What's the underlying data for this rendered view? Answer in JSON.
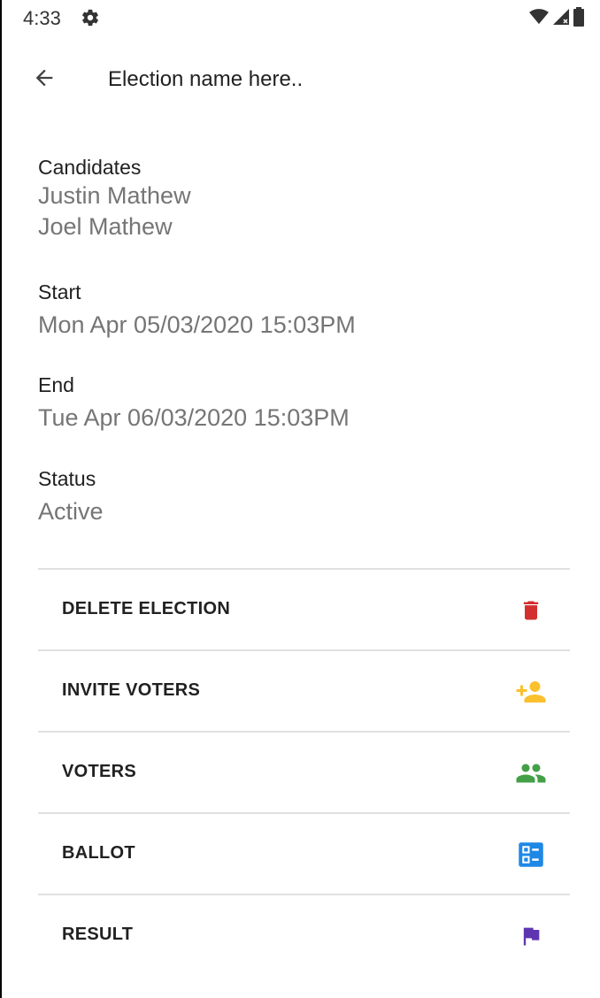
{
  "status_bar": {
    "time": "4:33",
    "icons": [
      "gear-icon",
      "wifi-icon",
      "signal-icon",
      "battery-icon"
    ]
  },
  "app_bar": {
    "back_icon": "arrow-back-icon",
    "title": "Election name here.."
  },
  "details": {
    "candidates": {
      "label": "Candidates",
      "values": [
        "Justin Mathew",
        "Joel Mathew"
      ]
    },
    "start": {
      "label": "Start",
      "value": "Mon Apr 05/03/2020 15:03PM"
    },
    "end": {
      "label": "End",
      "value": "Tue Apr 06/03/2020 15:03PM"
    },
    "status": {
      "label": "Status",
      "value": "Active"
    }
  },
  "actions": [
    {
      "label": "DELETE ELECTION",
      "icon": "trash-icon",
      "color": "#d32f2f"
    },
    {
      "label": "INVITE VOTERS",
      "icon": "person-add-icon",
      "color": "#fbc02d"
    },
    {
      "label": "VOTERS",
      "icon": "people-icon",
      "color": "#43a047"
    },
    {
      "label": "BALLOT",
      "icon": "ballot-icon",
      "color": "#1e88e5"
    },
    {
      "label": "RESULT",
      "icon": "flag-icon",
      "color": "#5e35b1"
    }
  ]
}
